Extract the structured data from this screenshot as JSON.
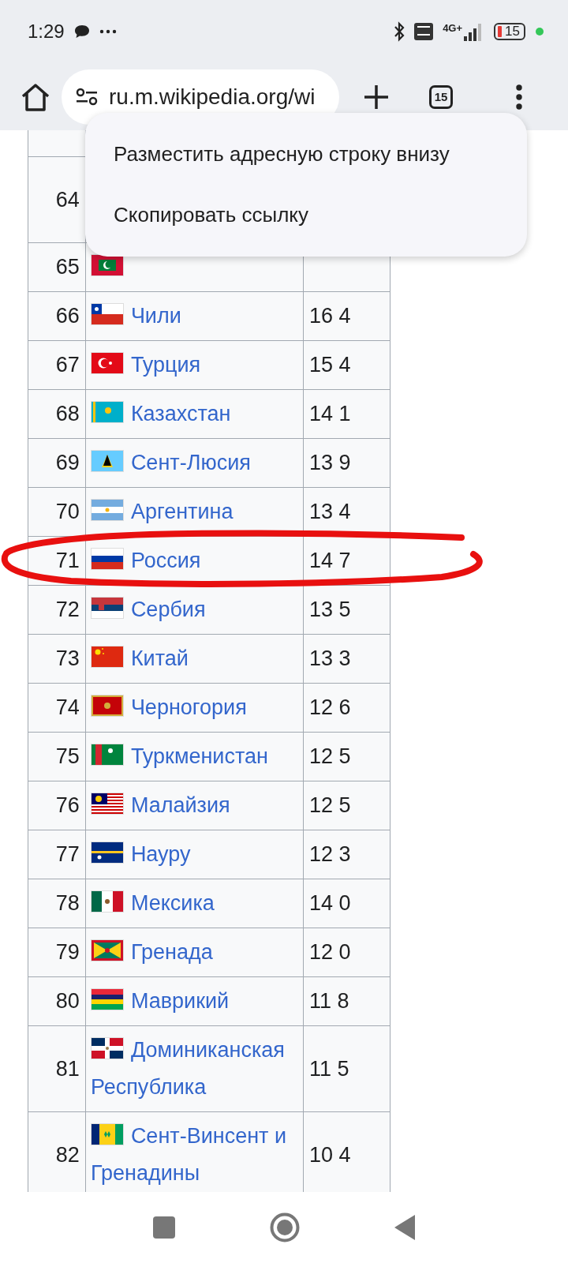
{
  "status_bar": {
    "time": "1:29",
    "network": "4G+",
    "battery": "15"
  },
  "toolbar": {
    "url": "ru.m.wikipedia.org/wi",
    "tab_count": "15"
  },
  "table": {
    "rows": [
      {
        "kind": "cut"
      },
      {
        "kind": "covered",
        "rank": "64"
      },
      {
        "kind": "flag_only",
        "rank": "65"
      },
      {
        "kind": "country",
        "rank": "66",
        "country": "Чили",
        "value": "16 4"
      },
      {
        "kind": "country",
        "rank": "67",
        "country": "Турция",
        "value": "15 4"
      },
      {
        "kind": "country",
        "rank": "68",
        "country": "Казахстан",
        "value": "14 1"
      },
      {
        "kind": "country",
        "rank": "69",
        "country": "Сент-Люсия",
        "value": "13 9"
      },
      {
        "kind": "country",
        "rank": "70",
        "country": "Аргентина",
        "value": "13 4"
      },
      {
        "kind": "country",
        "rank": "71",
        "country": "Россия",
        "value": "14 7"
      },
      {
        "kind": "country",
        "rank": "72",
        "country": "Сербия",
        "value": "13 5"
      },
      {
        "kind": "country",
        "rank": "73",
        "country": "Китай",
        "value": "13 3"
      },
      {
        "kind": "country",
        "rank": "74",
        "country": "Черногория",
        "value": "12 6"
      },
      {
        "kind": "country",
        "rank": "75",
        "country": "Туркменистан",
        "value": "12 5"
      },
      {
        "kind": "country",
        "rank": "76",
        "country": "Малайзия",
        "value": "12 5"
      },
      {
        "kind": "country",
        "rank": "77",
        "country": "Науру",
        "value": "12 3"
      },
      {
        "kind": "country",
        "rank": "78",
        "country": "Мексика",
        "value": "14 0"
      },
      {
        "kind": "country",
        "rank": "79",
        "country": "Гренада",
        "value": "12 0"
      },
      {
        "kind": "country",
        "rank": "80",
        "country": "Маврикий",
        "value": "11 8"
      },
      {
        "kind": "country",
        "rank": "81",
        "country": "Доминиканская Республика",
        "value": "11 5"
      },
      {
        "kind": "country",
        "rank": "82",
        "country": "Сент-Винсент и Гренадины",
        "value": "10 4"
      }
    ]
  },
  "menu": {
    "items": [
      "Разместить адресную строку внизу",
      "Скопировать ссылку"
    ]
  }
}
